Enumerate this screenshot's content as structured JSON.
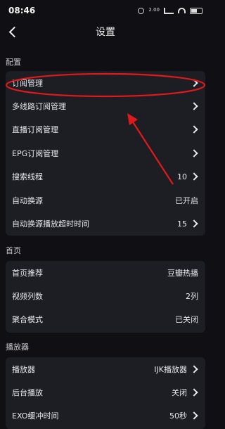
{
  "status_bar": {
    "time": "08:46",
    "speed_text": "2.00",
    "icons": [
      "alarm-icon",
      "network-speed",
      "signal-icon",
      "wifi-icon",
      "battery-icon"
    ]
  },
  "header": {
    "title": "设置",
    "back_icon": "chevron-left-icon"
  },
  "sections": {
    "config": {
      "title": "配置",
      "items": [
        {
          "label": "订阅管理",
          "value": ""
        },
        {
          "label": "多线路订阅管理",
          "value": ""
        },
        {
          "label": "直播订阅管理",
          "value": ""
        },
        {
          "label": "EPG订阅管理",
          "value": ""
        },
        {
          "label": "搜索线程",
          "value": "10"
        },
        {
          "label": "自动换源",
          "value": "已开启"
        },
        {
          "label": "自动换源播放超时时间",
          "value": "15"
        }
      ]
    },
    "home": {
      "title": "首页",
      "items": [
        {
          "label": "首页推荐",
          "value": "豆瓣热播"
        },
        {
          "label": "视频列数",
          "value": "2列"
        },
        {
          "label": "聚合模式",
          "value": "已关闭"
        }
      ]
    },
    "player": {
      "title": "播放器",
      "items": [
        {
          "label": "播放器",
          "value": "IJK播放器"
        },
        {
          "label": "后台播放",
          "value": "关闭"
        },
        {
          "label": "EXO缓冲时间",
          "value": "50秒"
        }
      ]
    }
  },
  "annotation": {
    "color": "#e01a1a"
  }
}
